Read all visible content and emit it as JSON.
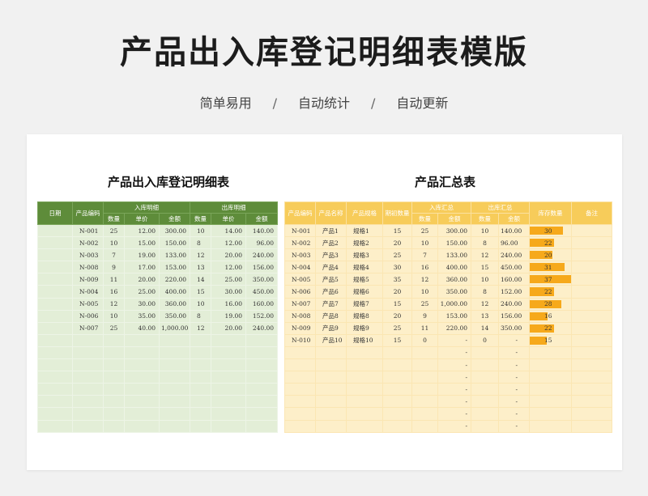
{
  "header": {
    "title": "产品出入库登记明细表模版",
    "features": [
      "简单易用",
      "自动统计",
      "自动更新"
    ],
    "separator": "/"
  },
  "left_sheet": {
    "title": "产品出入库登记明细表",
    "headers": {
      "date": "日期",
      "code": "产品编码",
      "in_group": "入库明细",
      "out_group": "出库明细",
      "qty": "数量",
      "price": "单价",
      "amount": "金额"
    },
    "rows": [
      {
        "date": "",
        "code": "N-001",
        "in_qty": "25",
        "in_price": "12.00",
        "in_amount": "300.00",
        "out_qty": "10",
        "out_price": "14.00",
        "out_amount": "140.00"
      },
      {
        "date": "",
        "code": "N-002",
        "in_qty": "10",
        "in_price": "15.00",
        "in_amount": "150.00",
        "out_qty": "8",
        "out_price": "12.00",
        "out_amount": "96.00"
      },
      {
        "date": "",
        "code": "N-003",
        "in_qty": "7",
        "in_price": "19.00",
        "in_amount": "133.00",
        "out_qty": "12",
        "out_price": "20.00",
        "out_amount": "240.00"
      },
      {
        "date": "",
        "code": "N-008",
        "in_qty": "9",
        "in_price": "17.00",
        "in_amount": "153.00",
        "out_qty": "13",
        "out_price": "12.00",
        "out_amount": "156.00"
      },
      {
        "date": "",
        "code": "N-009",
        "in_qty": "11",
        "in_price": "20.00",
        "in_amount": "220.00",
        "out_qty": "14",
        "out_price": "25.00",
        "out_amount": "350.00"
      },
      {
        "date": "",
        "code": "N-004",
        "in_qty": "16",
        "in_price": "25.00",
        "in_amount": "400.00",
        "out_qty": "15",
        "out_price": "30.00",
        "out_amount": "450.00"
      },
      {
        "date": "",
        "code": "N-005",
        "in_qty": "12",
        "in_price": "30.00",
        "in_amount": "360.00",
        "out_qty": "10",
        "out_price": "16.00",
        "out_amount": "160.00"
      },
      {
        "date": "",
        "code": "N-006",
        "in_qty": "10",
        "in_price": "35.00",
        "in_amount": "350.00",
        "out_qty": "8",
        "out_price": "19.00",
        "out_amount": "152.00"
      },
      {
        "date": "",
        "code": "N-007",
        "in_qty": "25",
        "in_price": "40.00",
        "in_amount": "1,000.00",
        "out_qty": "12",
        "out_price": "20.00",
        "out_amount": "240.00"
      },
      {
        "date": "",
        "code": "",
        "in_qty": "",
        "in_price": "",
        "in_amount": "",
        "out_qty": "",
        "out_price": "",
        "out_amount": ""
      },
      {
        "date": "",
        "code": "",
        "in_qty": "",
        "in_price": "",
        "in_amount": "",
        "out_qty": "",
        "out_price": "",
        "out_amount": ""
      },
      {
        "date": "",
        "code": "",
        "in_qty": "",
        "in_price": "",
        "in_amount": "",
        "out_qty": "",
        "out_price": "",
        "out_amount": ""
      },
      {
        "date": "",
        "code": "",
        "in_qty": "",
        "in_price": "",
        "in_amount": "",
        "out_qty": "",
        "out_price": "",
        "out_amount": ""
      },
      {
        "date": "",
        "code": "",
        "in_qty": "",
        "in_price": "",
        "in_amount": "",
        "out_qty": "",
        "out_price": "",
        "out_amount": ""
      },
      {
        "date": "",
        "code": "",
        "in_qty": "",
        "in_price": "",
        "in_amount": "",
        "out_qty": "",
        "out_price": "",
        "out_amount": ""
      },
      {
        "date": "",
        "code": "",
        "in_qty": "",
        "in_price": "",
        "in_amount": "",
        "out_qty": "",
        "out_price": "",
        "out_amount": ""
      },
      {
        "date": "",
        "code": "",
        "in_qty": "",
        "in_price": "",
        "in_amount": "",
        "out_qty": "",
        "out_price": "",
        "out_amount": ""
      }
    ]
  },
  "right_sheet": {
    "title": "产品汇总表",
    "headers": {
      "code": "产品编码",
      "name": "产品名称",
      "spec": "产品规格",
      "opening": "期初数量",
      "in_group": "入库汇总",
      "out_group": "出库汇总",
      "qty": "数量",
      "amount": "金额",
      "stock": "库存数量",
      "note": "备注"
    },
    "stock_max": 37,
    "rows": [
      {
        "code": "N-001",
        "name": "产品1",
        "spec": "规格1",
        "opening": "15",
        "in_qty": "25",
        "in_amount": "300.00",
        "out_qty": "10",
        "out_amount": "140.00",
        "stock": 30
      },
      {
        "code": "N-002",
        "name": "产品2",
        "spec": "规格2",
        "opening": "20",
        "in_qty": "10",
        "in_amount": "150.00",
        "out_qty": "8",
        "out_amount": "96.00",
        "stock": 22
      },
      {
        "code": "N-003",
        "name": "产品3",
        "spec": "规格3",
        "opening": "25",
        "in_qty": "7",
        "in_amount": "133.00",
        "out_qty": "12",
        "out_amount": "240.00",
        "stock": 20
      },
      {
        "code": "N-004",
        "name": "产品4",
        "spec": "规格4",
        "opening": "30",
        "in_qty": "16",
        "in_amount": "400.00",
        "out_qty": "15",
        "out_amount": "450.00",
        "stock": 31
      },
      {
        "code": "N-005",
        "name": "产品5",
        "spec": "规格5",
        "opening": "35",
        "in_qty": "12",
        "in_amount": "360.00",
        "out_qty": "10",
        "out_amount": "160.00",
        "stock": 37
      },
      {
        "code": "N-006",
        "name": "产品6",
        "spec": "规格6",
        "opening": "20",
        "in_qty": "10",
        "in_amount": "350.00",
        "out_qty": "8",
        "out_amount": "152.00",
        "stock": 22
      },
      {
        "code": "N-007",
        "name": "产品7",
        "spec": "规格7",
        "opening": "15",
        "in_qty": "25",
        "in_amount": "1,000.00",
        "out_qty": "12",
        "out_amount": "240.00",
        "stock": 28
      },
      {
        "code": "N-008",
        "name": "产品8",
        "spec": "规格8",
        "opening": "20",
        "in_qty": "9",
        "in_amount": "153.00",
        "out_qty": "13",
        "out_amount": "156.00",
        "stock": 16
      },
      {
        "code": "N-009",
        "name": "产品9",
        "spec": "规格9",
        "opening": "25",
        "in_qty": "11",
        "in_amount": "220.00",
        "out_qty": "14",
        "out_amount": "350.00",
        "stock": 22
      },
      {
        "code": "N-010",
        "name": "产品10",
        "spec": "规格10",
        "opening": "15",
        "in_qty": "0",
        "in_amount": "-",
        "out_qty": "0",
        "out_amount": "-",
        "stock": 15
      },
      {
        "code": "",
        "name": "",
        "spec": "",
        "opening": "",
        "in_qty": "",
        "in_amount": "-",
        "out_qty": "",
        "out_amount": "-",
        "stock": null
      },
      {
        "code": "",
        "name": "",
        "spec": "",
        "opening": "",
        "in_qty": "",
        "in_amount": "-",
        "out_qty": "",
        "out_amount": "-",
        "stock": null
      },
      {
        "code": "",
        "name": "",
        "spec": "",
        "opening": "",
        "in_qty": "",
        "in_amount": "-",
        "out_qty": "",
        "out_amount": "-",
        "stock": null
      },
      {
        "code": "",
        "name": "",
        "spec": "",
        "opening": "",
        "in_qty": "",
        "in_amount": "-",
        "out_qty": "",
        "out_amount": "-",
        "stock": null
      },
      {
        "code": "",
        "name": "",
        "spec": "",
        "opening": "",
        "in_qty": "",
        "in_amount": "-",
        "out_qty": "",
        "out_amount": "-",
        "stock": null
      },
      {
        "code": "",
        "name": "",
        "spec": "",
        "opening": "",
        "in_qty": "",
        "in_amount": "-",
        "out_qty": "",
        "out_amount": "-",
        "stock": null
      },
      {
        "code": "",
        "name": "",
        "spec": "",
        "opening": "",
        "in_qty": "",
        "in_amount": "-",
        "out_qty": "",
        "out_amount": "-",
        "stock": null
      }
    ]
  },
  "colors": {
    "left_header": "#5e8c3a",
    "left_body": "#e3eed7",
    "right_header": "#f7cc5a",
    "right_body": "#fdefc9",
    "stock_bar": "#f6a91b"
  }
}
